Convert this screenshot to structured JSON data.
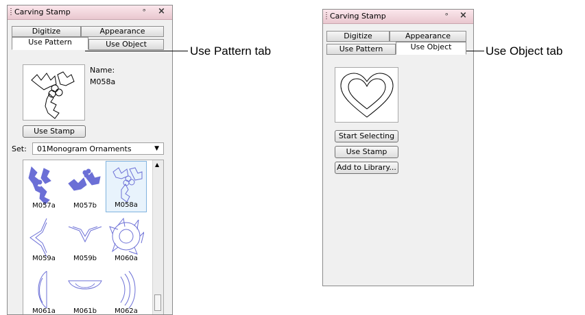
{
  "left_panel": {
    "title": "Carving Stamp",
    "pin_glyph": "↕",
    "close_glyph": "×",
    "tabs_row1": [
      "Digitize",
      "Appearance"
    ],
    "tabs_row2": [
      "Use Pattern",
      "Use Object"
    ],
    "active_tab": "Use Pattern",
    "name_label": "Name:",
    "name_value": "M058a",
    "use_stamp_label": "Use Stamp",
    "set_label": "Set:",
    "set_value": "01Monogram Ornaments",
    "patterns": [
      {
        "label": "M057a",
        "icon": "holly-filled-icon"
      },
      {
        "label": "M057b",
        "icon": "holly-filled-wide-icon"
      },
      {
        "label": "M058a",
        "icon": "holly-outline-icon",
        "selected": true
      },
      {
        "label": "M059a",
        "icon": "corner-left-icon"
      },
      {
        "label": "M059b",
        "icon": "corner-down-icon"
      },
      {
        "label": "M060a",
        "icon": "wreath-icon"
      },
      {
        "label": "M061a",
        "icon": "half-circle-icon"
      },
      {
        "label": "M061b",
        "icon": "bowl-icon"
      },
      {
        "label": "M062a",
        "icon": "arcs-icon"
      }
    ]
  },
  "right_panel": {
    "title": "Carving Stamp",
    "pin_glyph": "↕",
    "close_glyph": "×",
    "tabs_row1": [
      "Digitize",
      "Appearance"
    ],
    "tabs_row2": [
      "Use Pattern",
      "Use Object"
    ],
    "active_tab": "Use Object",
    "start_selecting_label": "Start Selecting",
    "use_stamp_label": "Use Stamp",
    "add_to_library_label": "Add to Library..."
  },
  "callouts": {
    "left": "Use Pattern tab",
    "right": "Use Object tab"
  },
  "colors": {
    "pattern_blue": "#6b6fd6",
    "titlebar_pink": "#f3d7de"
  }
}
